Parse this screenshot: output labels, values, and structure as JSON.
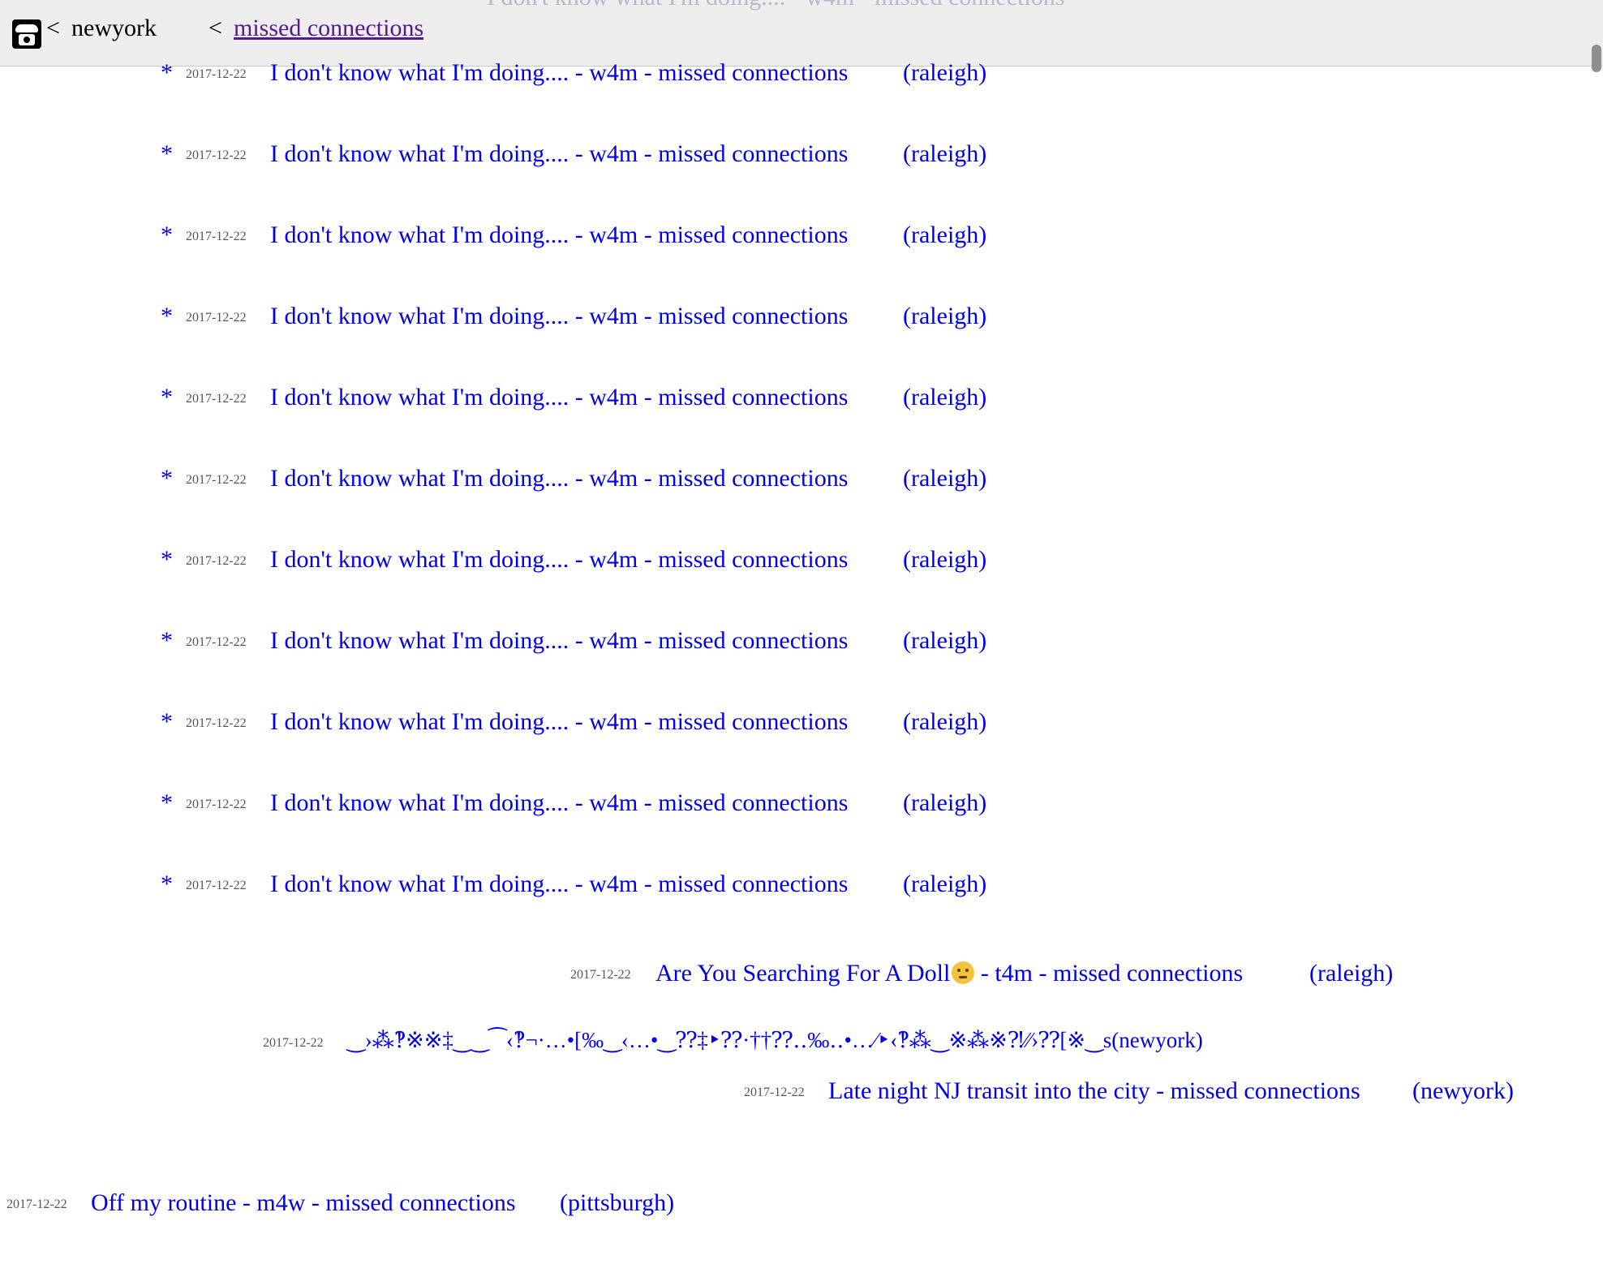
{
  "header": {
    "sep1": "<",
    "city": "newyork",
    "sep2": "<",
    "category_link": "missed connections"
  },
  "repeat": {
    "bullet": "*",
    "date": "2017-12-22",
    "title": "I don't know what I'm doing.... - w4m - missed connections",
    "location": "(raleigh)"
  },
  "posts": {
    "doll": {
      "date": "2017-12-22",
      "title": "Are You Searching For A Doll",
      "title_tail": " - t4m - missed connections",
      "location": "(raleigh)"
    },
    "garbled": {
      "date": "2017-12-22",
      "title": "‿›⁂‽※※‡‿‿⁀‹‽¬·…•[‰‿‹…•‿⁇‡‣⁇·††⁇‥‰‥•…⁄‣‹‽⁂‿※⁂※⁈⁄⁄›⁇[※‿s(newyork)"
    },
    "nj": {
      "date": "2017-12-22",
      "title": "Late night NJ transit into the city - missed connections",
      "location": "(newyork)"
    },
    "routine": {
      "date": "2017-12-22",
      "title": "Off my routine - m4w - missed connections",
      "location": "(pittsburgh)"
    }
  }
}
